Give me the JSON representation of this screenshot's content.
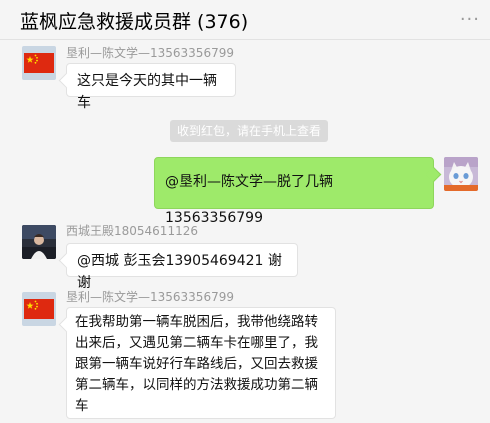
{
  "header": {
    "title": "蓝枫应急救援成员群 (376)",
    "more_icon": "···"
  },
  "messages": [
    {
      "sender": "垦利—陈文学—13563356799",
      "text": "这只是今天的其中一辆车",
      "avatar": "china-flag-icon"
    },
    {
      "system": true,
      "text": "收到红包，请在手机上查看"
    },
    {
      "self": true,
      "text": "@垦利—陈文学—脱了几辆13563356799",
      "avatar": "cat-avatar-icon"
    },
    {
      "sender": "西城王殿18054611126",
      "text": "@西城   彭玉会13905469421 谢谢",
      "avatar": "person-photo-avatar-icon"
    },
    {
      "sender": "垦利—陈文学—13563356799",
      "text_lines": [
        "在我帮助第一辆车脱困后，我带他绕路转",
        "出来后，又遇见第二辆车卡在哪里了，我",
        "跟第一辆车说好行车路线后，又回去救援",
        "第二辆车，以同样的方法救援成功第二辆",
        "车"
      ],
      "avatar": "china-flag-icon"
    }
  ],
  "colors": {
    "self_bubble": "#9eea6a",
    "other_bubble": "#ffffff",
    "system_notice_bg": "#dadada",
    "flag_red": "#de2910",
    "flag_star": "#ffde00"
  }
}
